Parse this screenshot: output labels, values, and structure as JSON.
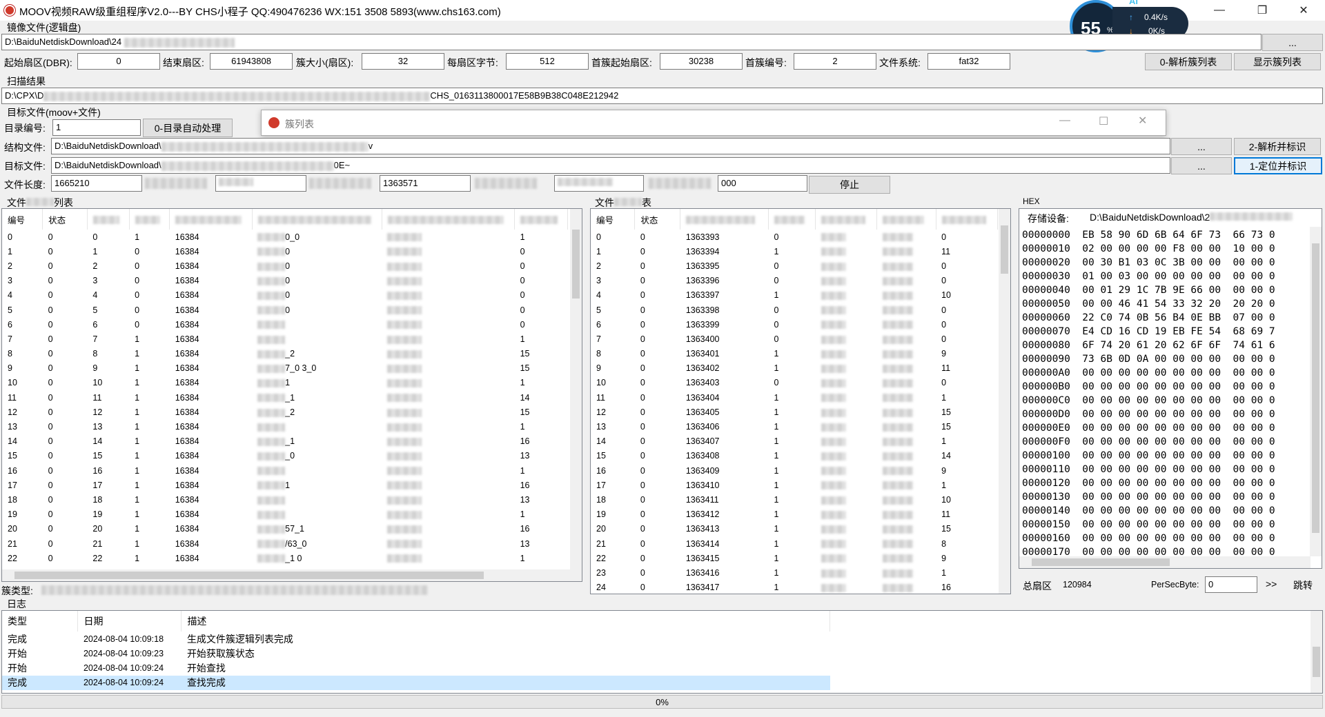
{
  "window": {
    "title": "MOOV视频RAW级重组程序V2.0---BY CHS小程子  QQ:490476236 WX:151 3508 5893(www.chs163.com)",
    "minimize": "—",
    "restore": "❐",
    "close": "✕"
  },
  "widget": {
    "percent": "55",
    "percent_sign": "%",
    "up_speed": "0.4K/s",
    "down_speed": "0K/s",
    "ai": "AI"
  },
  "image_file": {
    "label": "镜像文件(逻辑盘)",
    "path": "D:\\BaiduNetdiskDownload\\24",
    "browse": "..."
  },
  "params": {
    "start_sector_label": "起始扇区(DBR):",
    "start_sector": "0",
    "end_sector_label": "结束扇区:",
    "end_sector": "61943808",
    "cluster_size_label": "簇大小(扇区):",
    "cluster_size": "32",
    "bytes_per_sector_label": "每扇区字节:",
    "bytes_per_sector": "512",
    "first_cluster_start_label": "首簇起始扇区:",
    "first_cluster_start": "30238",
    "first_cluster_no_label": "首簇编号:",
    "first_cluster_no": "2",
    "fs_label": "文件系统:",
    "fs": "fat32",
    "parse_btn": "0-解析簇列表",
    "show_btn": "显示簇列表"
  },
  "scan": {
    "label": "扫描结果",
    "path_prefix": "D:\\CPX\\D",
    "path_suffix": "CHS_0163113800017E58B9B38C048E212942"
  },
  "target": {
    "label": "目标文件(moov+文件)",
    "dir_no_label": "目录编号:",
    "dir_no": "1",
    "auto_btn": "0-目录自动处理",
    "struct_label": "结构文件:",
    "struct_path": "D:\\BaiduNetdiskDownload\\",
    "struct_tail": "v",
    "struct_browse": "...",
    "parse_mark_btn": "2-解析并标识",
    "target_label": "目标文件:",
    "target_path": "D:\\BaiduNetdiskDownload\\",
    "target_tail": "0E~",
    "target_browse": "...",
    "locate_mark_btn": "1-定位并标识",
    "length_label": "文件长度:",
    "length": "1665210",
    "mid_value": "1363571",
    "right_value": "000",
    "stop_btn": "停止"
  },
  "cluster_dialog": {
    "title": "簇列表"
  },
  "left_list": {
    "label": "文件",
    "label_tail": "列表",
    "headers": [
      "编号",
      "状态"
    ],
    "rows": [
      [
        "0",
        "0",
        "0",
        "1",
        "16384",
        "0_0",
        "1"
      ],
      [
        "1",
        "0",
        "1",
        "0",
        "16384",
        "0",
        "0"
      ],
      [
        "2",
        "0",
        "2",
        "0",
        "16384",
        "0",
        "0"
      ],
      [
        "3",
        "0",
        "3",
        "0",
        "16384",
        "0",
        "0"
      ],
      [
        "4",
        "0",
        "4",
        "0",
        "16384",
        "0",
        "0"
      ],
      [
        "5",
        "0",
        "5",
        "0",
        "16384",
        "0",
        "0"
      ],
      [
        "6",
        "0",
        "6",
        "0",
        "16384",
        "",
        "0"
      ],
      [
        "7",
        "0",
        "7",
        "1",
        "16384",
        "",
        "1"
      ],
      [
        "8",
        "0",
        "8",
        "1",
        "16384",
        "_2",
        "15"
      ],
      [
        "9",
        "0",
        "9",
        "1",
        "16384",
        "7_0 3_0",
        "15"
      ],
      [
        "10",
        "0",
        "10",
        "1",
        "16384",
        "1",
        "1"
      ],
      [
        "11",
        "0",
        "11",
        "1",
        "16384",
        "_1",
        "14"
      ],
      [
        "12",
        "0",
        "12",
        "1",
        "16384",
        "_2",
        "15"
      ],
      [
        "13",
        "0",
        "13",
        "1",
        "16384",
        "",
        "1"
      ],
      [
        "14",
        "0",
        "14",
        "1",
        "16384",
        "_1",
        "16"
      ],
      [
        "15",
        "0",
        "15",
        "1",
        "16384",
        "_0",
        "13"
      ],
      [
        "16",
        "0",
        "16",
        "1",
        "16384",
        "",
        "1"
      ],
      [
        "17",
        "0",
        "17",
        "1",
        "16384",
        "1",
        "16"
      ],
      [
        "18",
        "0",
        "18",
        "1",
        "16384",
        "",
        "13"
      ],
      [
        "19",
        "0",
        "19",
        "1",
        "16384",
        "",
        "1"
      ],
      [
        "20",
        "0",
        "20",
        "1",
        "16384",
        "57_1",
        "16"
      ],
      [
        "21",
        "0",
        "21",
        "1",
        "16384",
        "/63_0",
        "13"
      ],
      [
        "22",
        "0",
        "22",
        "1",
        "16384",
        "_1 0",
        "1"
      ]
    ],
    "cluster_type_label": "簇类型:"
  },
  "right_list": {
    "label": "文件",
    "label_tail": "表",
    "headers": [
      "编号",
      "状态"
    ],
    "rows": [
      [
        "0",
        "0",
        "1363393",
        "0",
        "0"
      ],
      [
        "1",
        "0",
        "1363394",
        "1",
        "11"
      ],
      [
        "2",
        "0",
        "1363395",
        "0",
        "0"
      ],
      [
        "3",
        "0",
        "1363396",
        "0",
        "0"
      ],
      [
        "4",
        "0",
        "1363397",
        "1",
        "10"
      ],
      [
        "5",
        "0",
        "1363398",
        "0",
        "0"
      ],
      [
        "6",
        "0",
        "1363399",
        "0",
        "0"
      ],
      [
        "7",
        "0",
        "1363400",
        "0",
        "0"
      ],
      [
        "8",
        "0",
        "1363401",
        "1",
        "9"
      ],
      [
        "9",
        "0",
        "1363402",
        "1",
        "11"
      ],
      [
        "10",
        "0",
        "1363403",
        "0",
        "0"
      ],
      [
        "11",
        "0",
        "1363404",
        "1",
        "1"
      ],
      [
        "12",
        "0",
        "1363405",
        "1",
        "15"
      ],
      [
        "13",
        "0",
        "1363406",
        "1",
        "15"
      ],
      [
        "14",
        "0",
        "1363407",
        "1",
        "1"
      ],
      [
        "15",
        "0",
        "1363408",
        "1",
        "14"
      ],
      [
        "16",
        "0",
        "1363409",
        "1",
        "9"
      ],
      [
        "17",
        "0",
        "1363410",
        "1",
        "1"
      ],
      [
        "18",
        "0",
        "1363411",
        "1",
        "10"
      ],
      [
        "19",
        "0",
        "1363412",
        "1",
        "11"
      ],
      [
        "20",
        "0",
        "1363413",
        "1",
        "15"
      ],
      [
        "21",
        "0",
        "1363414",
        "1",
        "8"
      ],
      [
        "22",
        "0",
        "1363415",
        "1",
        "9"
      ],
      [
        "23",
        "0",
        "1363416",
        "1",
        "1"
      ],
      [
        "24",
        "0",
        "1363417",
        "1",
        "16"
      ]
    ]
  },
  "hex": {
    "label": "HEX",
    "device_label": "存储设备:",
    "device_path": "D:\\BaiduNetdiskDownload\\2",
    "lines": [
      "00000000  EB 58 90 6D 6B 64 6F 73  66 73 0",
      "00000010  02 00 00 00 00 F8 00 00  10 00 0",
      "00000020  00 30 B1 03 0C 3B 00 00  00 00 0",
      "00000030  01 00 03 00 00 00 00 00  00 00 0",
      "00000040  00 01 29 1C 7B 9E 66 00  00 00 0",
      "00000050  00 00 46 41 54 33 32 20  20 20 0",
      "00000060  22 C0 74 0B 56 B4 0E BB  07 00 0",
      "00000070  E4 CD 16 CD 19 EB FE 54  68 69 7",
      "00000080  6F 74 20 61 20 62 6F 6F  74 61 6",
      "00000090  73 6B 0D 0A 00 00 00 00  00 00 0",
      "000000A0  00 00 00 00 00 00 00 00  00 00 0",
      "000000B0  00 00 00 00 00 00 00 00  00 00 0",
      "000000C0  00 00 00 00 00 00 00 00  00 00 0",
      "000000D0  00 00 00 00 00 00 00 00  00 00 0",
      "000000E0  00 00 00 00 00 00 00 00  00 00 0",
      "000000F0  00 00 00 00 00 00 00 00  00 00 0",
      "00000100  00 00 00 00 00 00 00 00  00 00 0",
      "00000110  00 00 00 00 00 00 00 00  00 00 0",
      "00000120  00 00 00 00 00 00 00 00  00 00 0",
      "00000130  00 00 00 00 00 00 00 00  00 00 0",
      "00000140  00 00 00 00 00 00 00 00  00 00 0",
      "00000150  00 00 00 00 00 00 00 00  00 00 0",
      "00000160  00 00 00 00 00 00 00 00  00 00 0",
      "00000170  00 00 00 00 00 00 00 00  00 00 0"
    ],
    "total_sectors_label": "总扇区",
    "total_sectors": "120984",
    "per_sec_label": "PerSecByte:",
    "per_sec_value": "0",
    "next_btn": ">>",
    "jump_btn": "跳转"
  },
  "log": {
    "label": "日志",
    "headers": [
      "类型",
      "日期",
      "描述"
    ],
    "rows": [
      [
        "完成",
        "2024-08-04 10:09:18",
        "生成文件簇逻辑列表完成"
      ],
      [
        "开始",
        "2024-08-04 10:09:23",
        "开始获取簇状态"
      ],
      [
        "开始",
        "2024-08-04 10:09:24",
        "开始查找"
      ],
      [
        "完成",
        "2024-08-04 10:09:24",
        "查找完成"
      ]
    ]
  },
  "progress": {
    "text": "0%",
    "value": 0
  }
}
